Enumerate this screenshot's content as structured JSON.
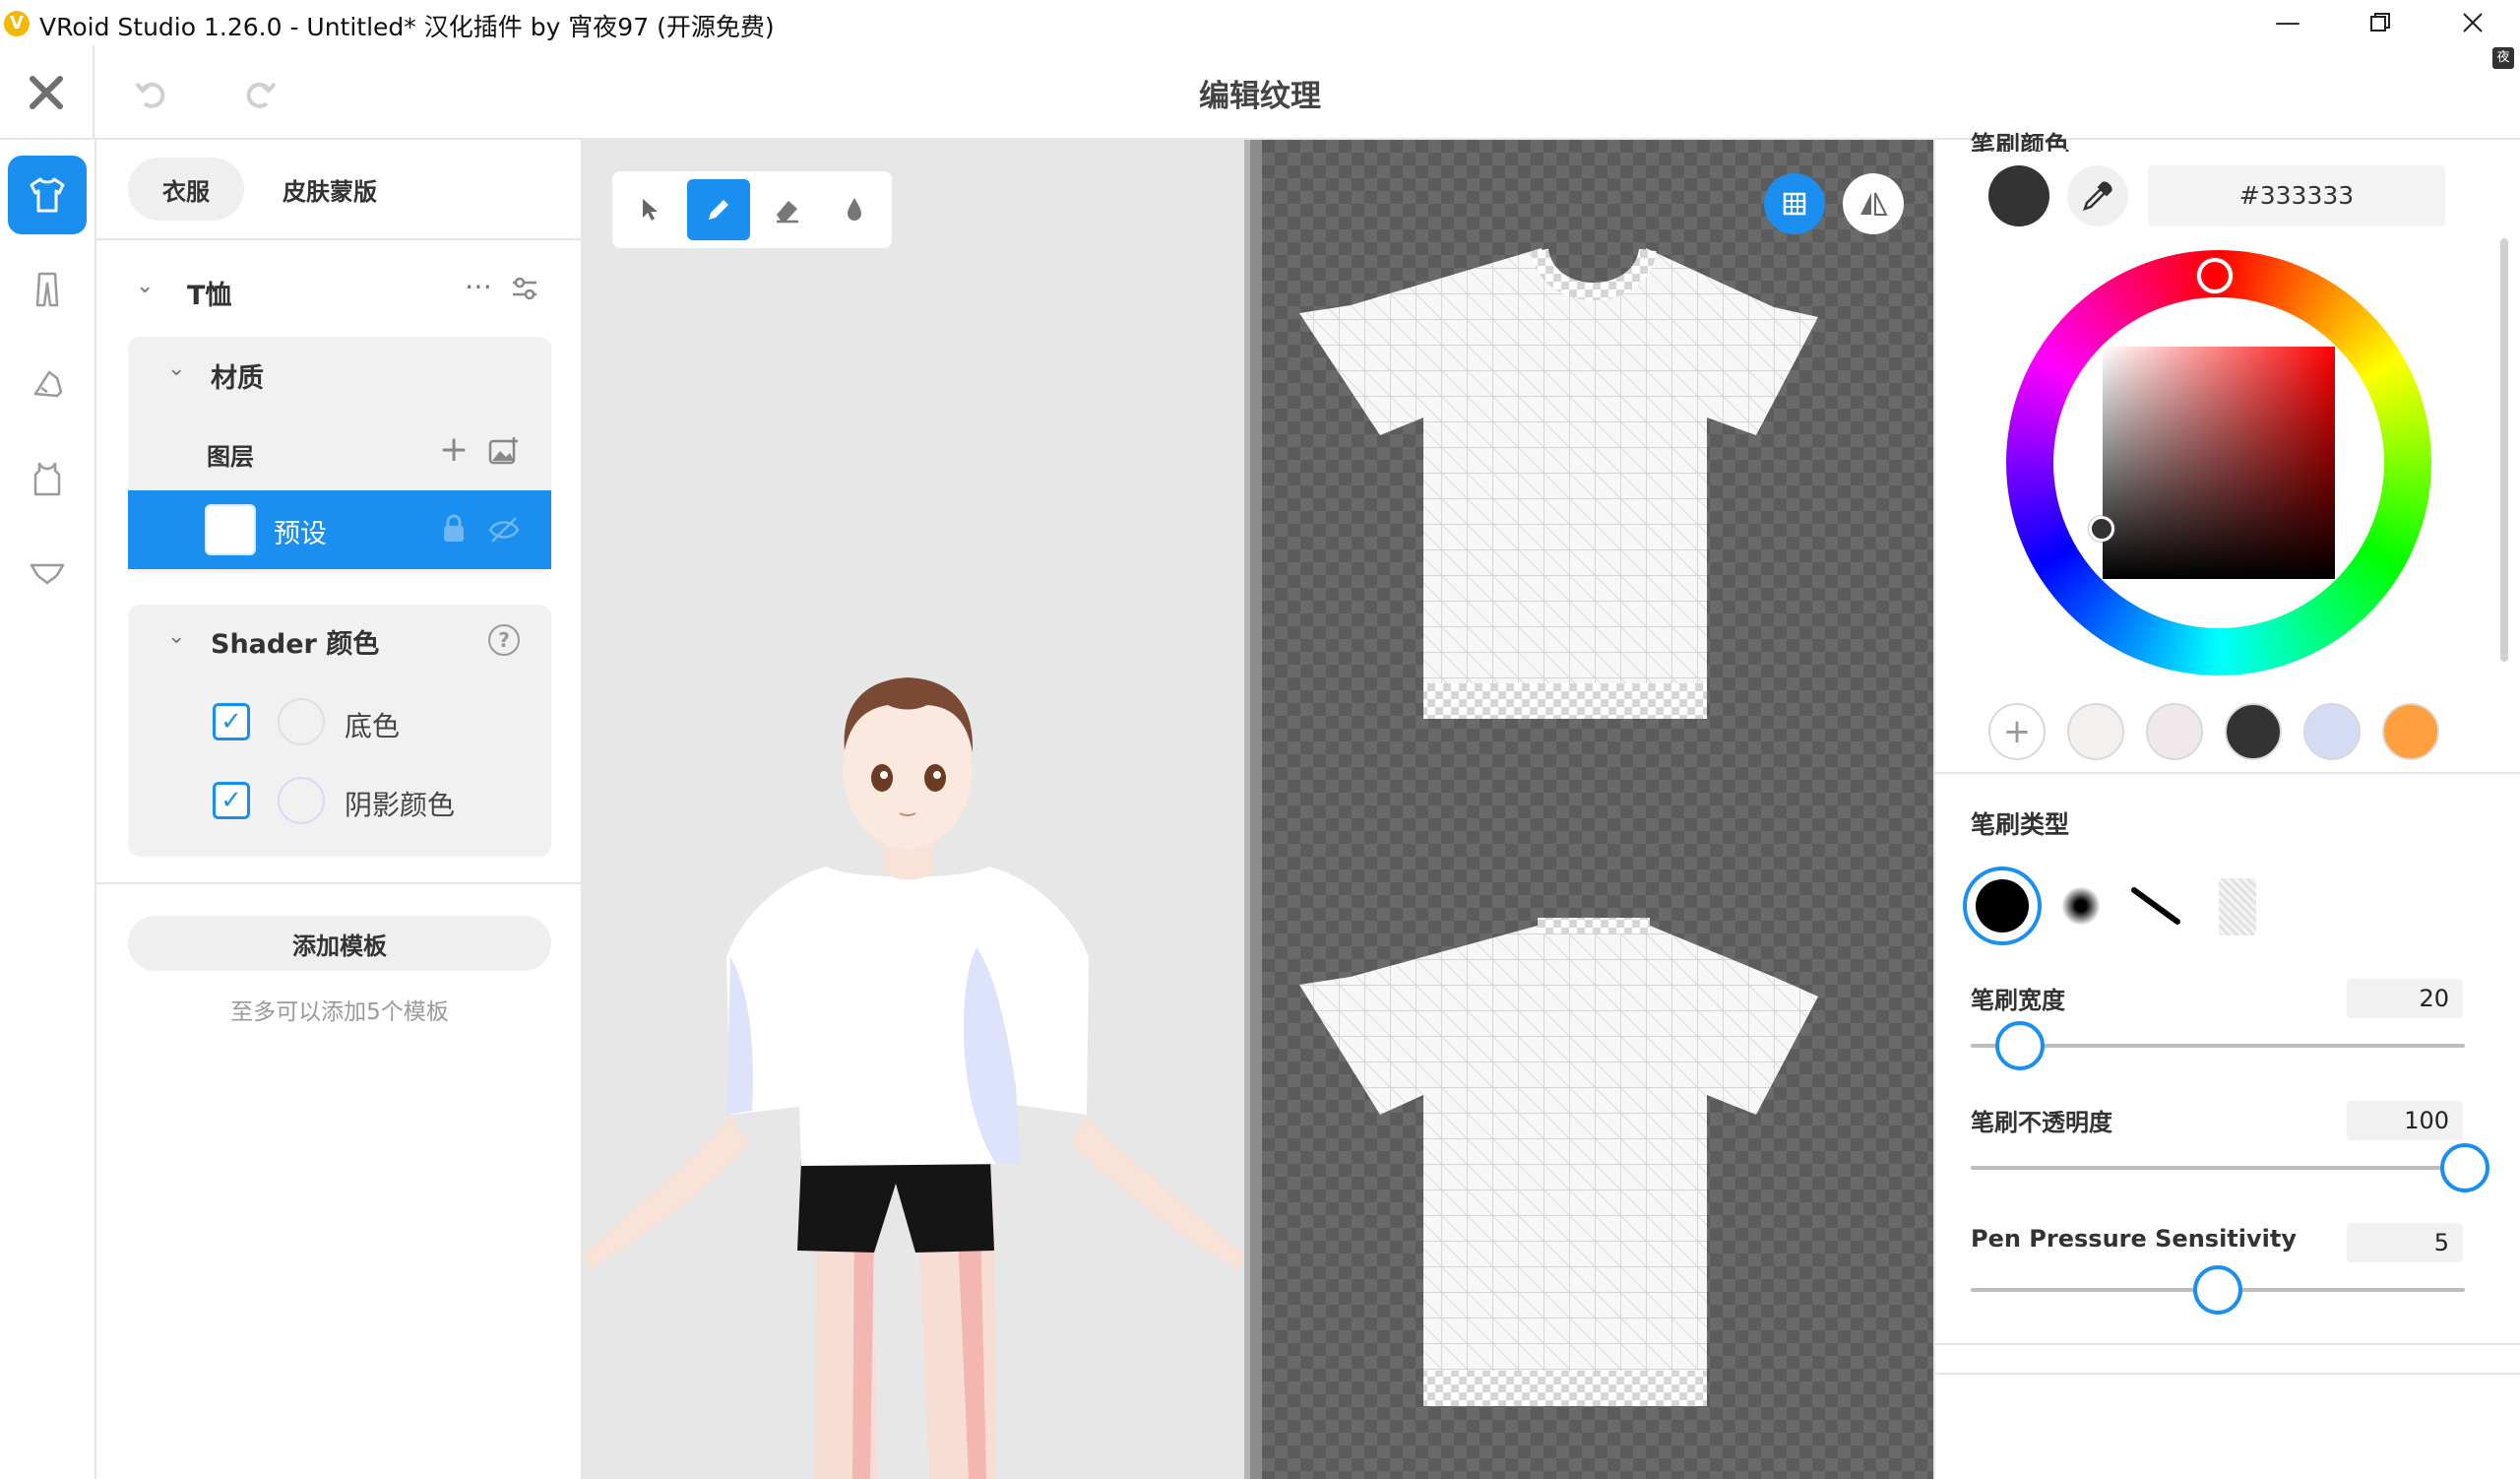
{
  "window": {
    "title": "VRoid Studio 1.26.0 - Untitled* 汉化插件 by 宵夜97 (开源免费)",
    "app_icon": "V",
    "controls": [
      "minimize-icon",
      "maximize-icon",
      "close-icon"
    ]
  },
  "header": {
    "page_title": "编辑纹理",
    "badge": "夜"
  },
  "nav": {
    "items": [
      "tshirt-icon",
      "pants-icon",
      "shoe-icon",
      "tanktop-icon",
      "underwear-icon"
    ],
    "active": "tshirt-icon"
  },
  "left_panel": {
    "tabs": [
      {
        "label": "衣服"
      },
      {
        "label": "皮肤蒙版"
      }
    ],
    "item_title": "T恤",
    "material_label": "材质",
    "layers_label": "图层",
    "layer_name": "预设",
    "shader_label": "Shader 颜色",
    "shader_colors": [
      {
        "label": "底色",
        "color": "#ffffff",
        "checked": true
      },
      {
        "label": "阴影颜色",
        "color": "#d4dbf5",
        "checked": true
      }
    ],
    "add_template": "添加模板",
    "template_hint": "至多可以添加5个模板"
  },
  "toolbar": {
    "tools": [
      "pointer-icon",
      "pen-icon",
      "eraser-icon",
      "fill-drop-icon"
    ],
    "active": "pen-icon"
  },
  "right_panel": {
    "brush_color_label": "笔刷颜色",
    "current_color": "#333333",
    "hex_value": "#333333",
    "presets": [
      "#f3f0ee",
      "#efe9ec",
      "#333333",
      "#d4dbf5",
      "#ff9f40"
    ],
    "brush_type_label": "笔刷类型",
    "sliders": [
      {
        "label": "笔刷宽度",
        "value": "20",
        "fraction": 0.1
      },
      {
        "label": "笔刷不透明度",
        "value": "100",
        "fraction": 1.0
      },
      {
        "label": "Pen Pressure Sensitivity",
        "value": "5",
        "fraction": 0.5
      }
    ]
  },
  "colors": {
    "accent": "#1a8ff0"
  }
}
